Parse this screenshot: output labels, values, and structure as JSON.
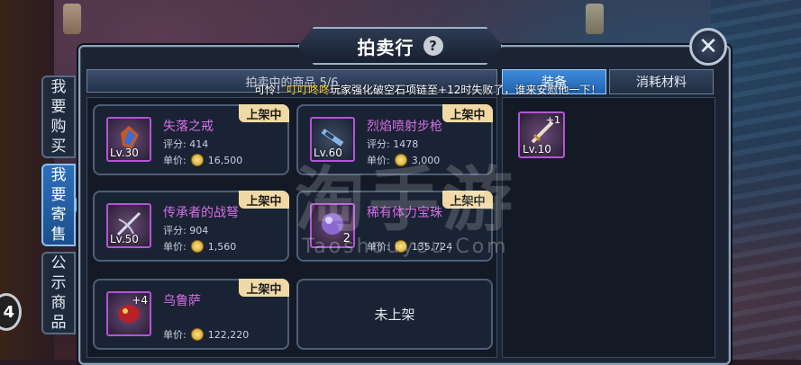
{
  "window": {
    "title": "拍卖行",
    "help_icon": "question-mark-icon",
    "close_icon": "close-icon"
  },
  "side_tabs": [
    {
      "label": [
        "我",
        "要",
        "购",
        "买"
      ],
      "active": false
    },
    {
      "label": [
        "我",
        "要",
        "寄",
        "售"
      ],
      "active": true
    },
    {
      "label": [
        "公",
        "示",
        "商",
        "品"
      ],
      "active": false
    }
  ],
  "header": {
    "selling_label": "拍卖中的商品 5/6",
    "tab_equip": "装备",
    "tab_consumables": "消耗材料"
  },
  "ticker": {
    "prefix": "可怜！",
    "player": "叮叮咚咚",
    "message": "玩家强化破空石项链至+12时失败了，谁来安慰他一下！"
  },
  "listings": [
    {
      "name": "失落之戒",
      "level": "Lv.30",
      "score_label": "评分:",
      "score": "414",
      "price_label": "单价:",
      "price": "16,500",
      "status": "上架中",
      "icon": "ring-icon"
    },
    {
      "name": "烈焰喷射步枪",
      "level": "Lv.60",
      "score_label": "评分:",
      "score": "1478",
      "price_label": "单价:",
      "price": "3,000",
      "status": "上架中",
      "icon": "rifle-icon"
    },
    {
      "name": "传承者的战弩",
      "level": "Lv.50",
      "score_label": "评分:",
      "score": "904",
      "price_label": "单价:",
      "price": "1,560",
      "status": "上架中",
      "icon": "crossbow-icon"
    },
    {
      "name": "稀有体力宝珠",
      "quantity": "2",
      "price_label": "单价:",
      "price": "135,724",
      "status": "上架中",
      "icon": "orb-icon"
    },
    {
      "name": "乌鲁萨",
      "enhance": "+4",
      "price_label": "单价:",
      "price": "122,220",
      "status": "上架中",
      "icon": "pet-icon"
    }
  ],
  "empty_slot": {
    "label": "未上架"
  },
  "inventory": [
    {
      "level": "Lv.10",
      "enhance": "+1",
      "icon": "sword-icon"
    }
  ],
  "watermark": {
    "cn": "淘手游",
    "en": "Taoshouyou.Com"
  },
  "left_button": {
    "label": "4"
  },
  "colors": {
    "item_name": "#d66ee8",
    "badge_bg": "#f0d9a4",
    "active_tab": "#2d6fb8",
    "ticker_highlight": "#ffd23a"
  }
}
